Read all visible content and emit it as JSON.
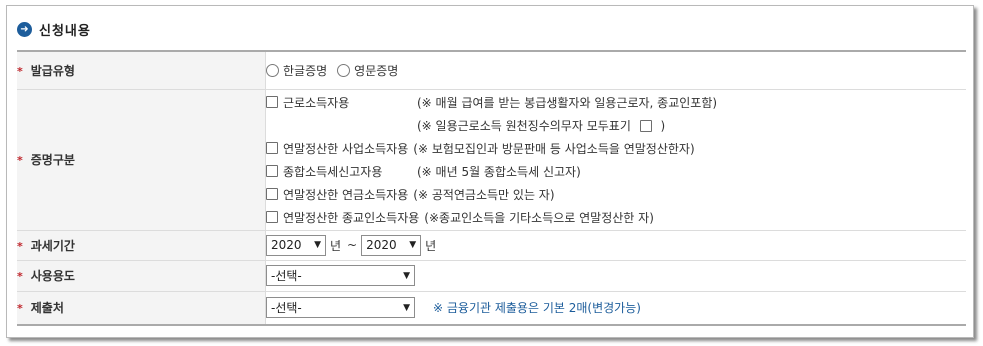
{
  "section": {
    "title": "신청내용",
    "icon": "arrow-right-icon"
  },
  "fields": {
    "issue_type": {
      "label": "발급유형",
      "options": [
        "한글증명",
        "영문증명"
      ]
    },
    "cert_type": {
      "label": "증명구분",
      "rows": [
        {
          "text": "근로소득자용",
          "note": "(※ 매월 급여를 받는 봉급생활자와 일용근로자, 종교인포함)"
        },
        {
          "note": "(※ 일용근로소득 원천징수의무자 모두표기",
          "note_end": ")"
        },
        {
          "text": "연말정산한 사업소득자용",
          "note": "(※ 보험모집인과 방문판매 등 사업소득을 연말정산한자)"
        },
        {
          "text": "종합소득세신고자용",
          "note": "(※ 매년 5월 종합소득세 신고자)"
        },
        {
          "text": "연말정산한 연금소득자용",
          "note": "(※ 공적연금소득만 있는 자)"
        },
        {
          "text": "연말정산한 종교인소득자용",
          "note": "(※종교인소득을 기타소득으로 연말정산한 자)"
        }
      ]
    },
    "tax_period": {
      "label": "과세기간",
      "from_year": "2020",
      "to_year": "2020",
      "unit": "년",
      "separator": "~"
    },
    "usage": {
      "label": "사용용도",
      "selected": "-선택-"
    },
    "submit_to": {
      "label": "제출처",
      "selected": "-선택-",
      "note": "※ 금융기관 제출용은 기본 2매(변경가능)"
    }
  },
  "colors": {
    "required": "#c0282e",
    "accent": "#1d5d9b"
  }
}
